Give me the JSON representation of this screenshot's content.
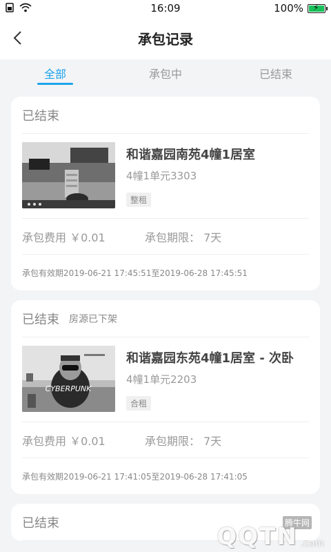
{
  "statusbar": {
    "time": "16:09",
    "battery": "100%",
    "battery_level": 1.0,
    "battery_color": "#18c15a"
  },
  "header": {
    "title": "承包记录"
  },
  "tabs": [
    {
      "label": "全部",
      "active": true
    },
    {
      "label": "承包中",
      "active": false
    },
    {
      "label": "已结束",
      "active": false
    }
  ],
  "colors": {
    "accent": "#1aa3ec",
    "background": "#f3f4f6"
  },
  "records": [
    {
      "status": "已结束",
      "status_note": "",
      "name": "和谐嘉园南苑4幢1居室",
      "unit": "4幢1单元3303",
      "tag": "整租",
      "fee_label": "承包费用",
      "fee_value": "￥0.01",
      "term_label": "承包期限：",
      "term_value": "7天",
      "validity": "承包有效期2019-06-21 17:45:51至2019-06-28 17:45:51"
    },
    {
      "status": "已结束",
      "status_note": "房源已下架",
      "name": "和谐嘉园东苑4幢1居室 - 次卧",
      "unit": "4幢1单元2203",
      "tag": "合租",
      "fee_label": "承包费用",
      "fee_value": "￥0.01",
      "term_label": "承包期限：",
      "term_value": "7天",
      "validity": "承包有效期2019-06-21 17:41:05至2019-06-28 17:41:05"
    },
    {
      "status": "已结束"
    }
  ],
  "watermark": {
    "small": "腾牛网",
    "big": "QQTN",
    "suffix": ".com"
  }
}
